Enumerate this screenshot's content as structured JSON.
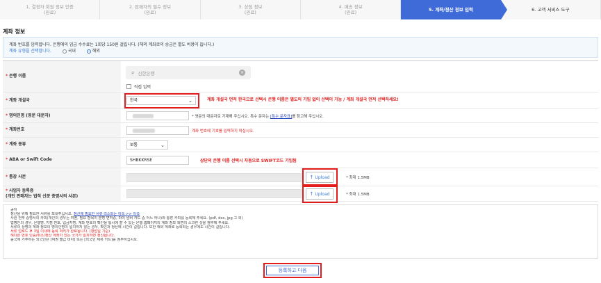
{
  "steps": [
    {
      "title": "1. 결정자 회원 정보 인증",
      "status": "(완료)"
    },
    {
      "title": "2. 판매자의 필수 정보",
      "status": "(완료)"
    },
    {
      "title": "3. 상점 정보",
      "status": "(완료)"
    },
    {
      "title": "4. 배송 정보",
      "status": "(완료)"
    },
    {
      "title": "5. 계좌/정산 정보 입력",
      "status": ""
    },
    {
      "title": "6. 고객 서비스 도구",
      "status": ""
    }
  ],
  "section_title": "계좌 정보",
  "info": {
    "line1": "계좌 번호를 입력합니다. 은행에의 입금 수수료는 1회당 150원 걸립니다. (해외 계좌로의 송금은 별도 비용이 듭니다.)",
    "account_type_prompt": "계좌 유형을 선택합니다.",
    "option_domestic": "국내",
    "option_overseas": "해외"
  },
  "form": {
    "bank_name": {
      "label": "은행 이름",
      "placeholder": "신한은행",
      "direct_input": "직접 입력"
    },
    "country": {
      "label": "계좌 개설국",
      "value": "한국",
      "note": "계좌 개설국 먼저 한국으로 선택시 은행 이름은 별도의 기입 없이 선택이 가능 / 계좌 개설국 먼저 선택하세요!"
    },
    "holder": {
      "label": "명의인명 (영문 대문자)",
      "hint_prefix": "* 영문의 대문자로 기재해 주십시오. 특수 문자는 ",
      "hint_link": "[특수 문자표]",
      "hint_suffix": "를 참고해 주십시오."
    },
    "account_no": {
      "label": "계좌번호",
      "hint": "계좌 번호에 기호를 입력하지 마십시오."
    },
    "account_type": {
      "label": "계좌 종류",
      "value": "보통"
    },
    "swift": {
      "label": "ABA or Swift Code",
      "value": "SHBKKRSE",
      "note": "상단의 은행 이름 선택시 자동으로 SWIFT코드 기입됨"
    },
    "passbook": {
      "label": "통장 사본",
      "upload": "Upload",
      "limit": "* 최대 1.5MB"
    },
    "business_reg": {
      "label": "사업자 등록증",
      "label2": "(개인 판매자는 법적 신분 증명서의 사본)",
      "upload": "Upload",
      "limit": "* 최대 1.5MB"
    }
  },
  "notice": {
    "title": "공지",
    "line1_a": "정산을 위해 필요한 서류를 보내주십시오. ",
    "line1_link": "정산에 필요한 서류 리스트는 이쪽 >> 이쪽",
    "line2": "사원 전부 증명서의 카피(개인의 경우는 여권, 필요 항목이 분명 면허증, 마이 넘버 카드 중 어느 하나)와 통장 카피를 등록해 주세요. (pdf, doc, jpg 그 외)",
    "line3": "법병인의 경우, 은행명, 지점 번호, 입금자명, 계좌 번호의 확인을 통시에 할 수 있는 은행 홈페이지의 계좌 정보 화면의 스크린 샷을 첨부해 주세요.",
    "line4": "서류의 상명과 계좌 정보의 명의인명이 일치하지 않는 경우, 확인과 정산에 시간이 걸립니다. 또한 해외 계좌로 등록되는 경우에도 시간이 걸립니다.",
    "line5": "서류 업로드 후 3일 이내에 등록 처리가 완료됩니다. (영업일 기준)",
    "line6": "해다른 번호 인증/취소/정산 계좌가 있는 국가가 일치하면 정산됩니다.",
    "line7": "중국에 거주하는 외국인은 [여권 별급 비자] 또는 [외국인 체류 카드]를 첨부하십시오."
  },
  "submit_label": "등록하고 다음",
  "colors": {
    "accent": "#3f6bd8",
    "highlight": "#e31b1b",
    "required": "#e33333"
  }
}
